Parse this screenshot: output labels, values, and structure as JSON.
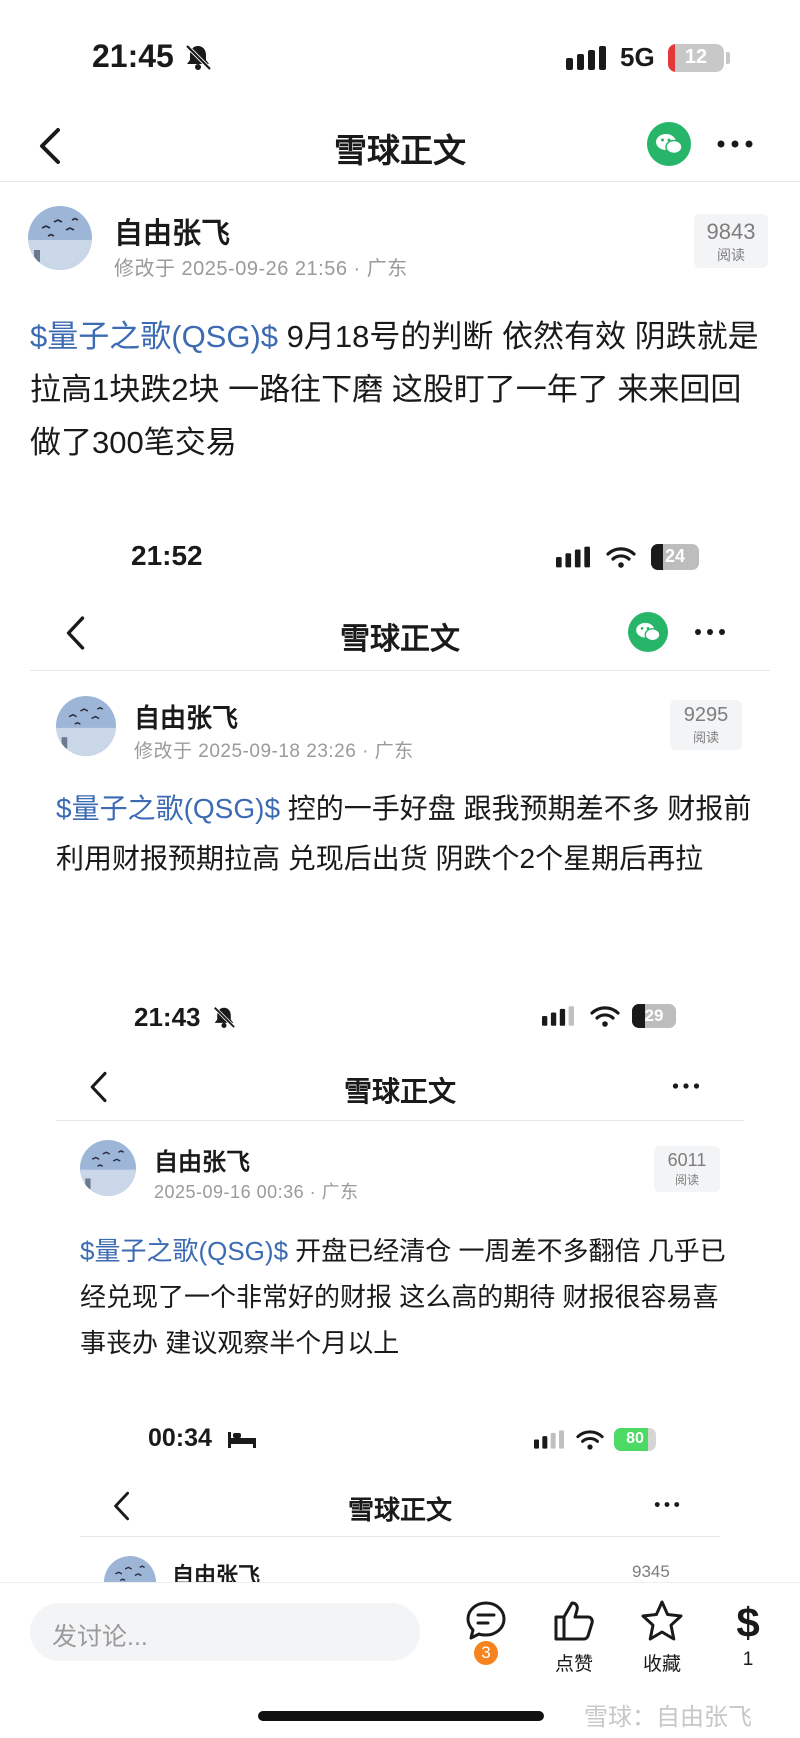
{
  "status_bar": {
    "time": "21:45",
    "network": "5G",
    "battery": "12",
    "battery_level": 0.12
  },
  "nav": {
    "title": "雪球正文"
  },
  "post": {
    "author": "自由张飞",
    "meta": "修改于 2025-09-26 21:56 · 广东",
    "reads": "9843",
    "reads_label": "阅读",
    "stock": "$量子之歌(QSG)$",
    "text": " 9月18号的判断 依然有效 阴跌就是 拉高1块跌2块 一路往下磨 这股盯了一年了 来来回回做了300笔交易"
  },
  "shot1": {
    "time": "21:52",
    "battery": "24",
    "battery_level": 0.24,
    "title": "雪球正文",
    "author": "自由张飞",
    "meta": "修改于 2025-09-18 23:26 · 广东",
    "reads": "9295",
    "reads_label": "阅读",
    "stock": "$量子之歌(QSG)$",
    "text": " 控的一手好盘 跟我预期差不多 财报前利用财报预期拉高 兑现后出货 阴跌个2个星期后再拉"
  },
  "shot2": {
    "time": "21:43",
    "battery": "29",
    "battery_level": 0.29,
    "title": "雪球正文",
    "author": "自由张飞",
    "meta": "2025-09-16 00:36 · 广东",
    "reads": "6011",
    "reads_label": "阅读",
    "stock": "$量子之歌(QSG)$",
    "text": " 开盘已经清仓 一周差不多翻倍 几乎已经兑现了一个非常好的财报 这么高的期待 财报很容易喜事丧办 建议观察半个月以上"
  },
  "shot3": {
    "time": "00:34",
    "battery": "80",
    "battery_level": 0.8,
    "title": "雪球正文",
    "author": "自由张飞",
    "reads": "9345"
  },
  "bottom_bar": {
    "placeholder": "发讨论...",
    "comment_count": "3",
    "like_label": "点赞",
    "fav_label": "收藏",
    "reward_count": "1",
    "watermark": "雪球：自由张飞"
  },
  "colors": {
    "stock_link": "#3c6bb3",
    "wechat": "#27b56a",
    "badge": "#f5841f",
    "battery_low": "#e5383b",
    "battery_ok": "#4cd964"
  },
  "icons": [
    "bell-off-icon",
    "signal-icon",
    "wifi-icon",
    "back-icon",
    "wechat-icon",
    "more-icon",
    "comment-icon",
    "like-icon",
    "star-icon",
    "dollar-icon",
    "bed-icon"
  ]
}
